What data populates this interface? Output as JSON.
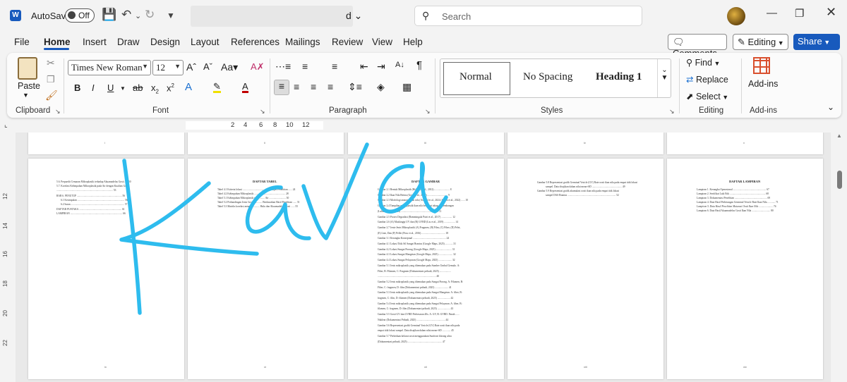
{
  "titlebar": {
    "app_letter": "W",
    "autosave_label": "AutoSave",
    "autosave_state": "Off",
    "doc_title_suffix": "d ⌄",
    "search_placeholder": "Search"
  },
  "tabs": [
    "File",
    "Home",
    "Insert",
    "Draw",
    "Design",
    "Layout",
    "References",
    "Mailings",
    "Review",
    "View",
    "Help"
  ],
  "active_tab": "Home",
  "actions": {
    "comments": "Comments",
    "editing": "Editing",
    "share": "Share"
  },
  "ribbon": {
    "clipboard": {
      "paste": "Paste",
      "label": "Clipboard"
    },
    "font": {
      "family": "Times New Roman",
      "size": "12",
      "label": "Font"
    },
    "paragraph": {
      "label": "Paragraph"
    },
    "styles": {
      "normal": "Normal",
      "no_spacing": "No Spacing",
      "heading1": "Heading 1",
      "label": "Styles"
    },
    "editing": {
      "find": "Find",
      "replace": "Replace",
      "select": "Select",
      "label": "Editing"
    },
    "addins": {
      "button": "Add-ins",
      "label": "Add-ins"
    }
  },
  "ruler": {
    "ticks": [
      "2",
      "4",
      "6",
      "8",
      "10",
      "12"
    ]
  },
  "vruler": {
    "ticks": [
      "12",
      "14",
      "16",
      "18",
      "20",
      "22"
    ]
  },
  "pages": {
    "top_numbers": [
      "i",
      "ii",
      "iii",
      "iv",
      "v"
    ],
    "p1": {
      "lines": [
        "5.6. Prepaedit Cemaran Mikroplastik terhadap Akuamadelus Gosti ..... 50",
        "5.7. Korelasi Kelimpahan Mikroplastik pada Air dengan Kualitas Gosti",
        "......................................................................................... 53",
        "BAB 6. PENUTUP ....................................................................... 56",
        "6.1 Kesimpulan .......................................................................... 56",
        "6.2 Saran .................................................................................... 57",
        "DAFTAR PUSTAKA ................................................................... 61",
        "LAMPIRAN .................................................................................. 66"
      ],
      "number": "ix"
    },
    "p2": {
      "title": "DAFTAR TABEL",
      "lines": [
        "Tabel 4.1 Kriteria lokasi ......................................... Sampel Penelitian ...... 24",
        "Tabel 4.2 Kelimpahan Mikroplastik ................................................. 28",
        "Tabel 5.1 Kelimpahan Mikroplastik pada ........ Air .......................... 30",
        "Tabel 5.2 Perbandingan Jenis Gosti ............. Berdasarkan Hasil Penelitian ...... 51",
        "Tabel 5.3 Matriks korelasi antara ............. Hulu dan Akuamadelus Gosti ...... 55"
      ],
      "number": "xi"
    },
    "p3": {
      "title": "DAFTAR GAMBAR",
      "lines": [
        "Gambar 2.1 Bentuk Mikroplastik (Hidalgo et al., 2012) ........................ 8",
        "Gambar 2.2 Ikan Nila Betina (Gosti et al., 2022) ................................ 9",
        "Gambar 2.3 Morfologi anatomi ikan nila (Asmaul et al., 2024; Sastra et al., 2022) ...... 10",
        "Gambar 2.4 Tampilan mikroplastik ikan nila berbagai tahap perkembangan",
        "(Lalameri et al., 2018) ........................................................... 11",
        "Gambar 2.5 Proses Degradasi (Bammingala Putri et al., 2017) ................. 12",
        "Gambar 2.6 (A) Muskingip UV dan (B) GVBD (Liu et al., 2019) ................. 14",
        "Gambar 2.7 Jenis-Jenis Mikroplastik (A) Fragmen, (B) Film, (C) Fiber, (D) Pelet,",
        "(E) Line, Dan (F) Pellet (Poso et al., 2016) ..................................... 18",
        "Gambar 3.1 Kerangka Konseptual .................................................... 24",
        "Gambar 4.1 Lokasi Titik Sil Sungai Brantas (Google Maps, 2025) ............ 31",
        "Gambar 4.2 Lokasi Sungai Porong (Google Maps, 2025) ......................... 31",
        "Gambar 4.3 Lokasi Sungai Mangetan (Google Maps, 2025) ...................... 32",
        "Gambar 4.4 Lokasi Sungai Pelayaran (Google Maps, 2025) ..................... 32",
        "Gambar 5.1 Jenis mikroplastik yang ditemukan pada Sumber Umbul Gemulo. A:",
        "Fiber, B: Filamen, C: Fragmen (Dokumentasi pribadi, 2025) ..................",
        "............................................................................................ 40",
        "Gambar 5.2 Jenis mikroplastik yang ditemukan pada Sungai Porong. A: Filamen, B:",
        "Fiber, C: fragmen, D: film (Dokumentasi pribadi, 2025) ..................... 41",
        "Gambar 5.3 Jenis mikroplastik yang ditemukan pada Sungai Mangetan. A: fiber, B:",
        "fragmen, C: film, D: filamen (Dokumentasi pribadi, 2025) .................... 42",
        "Gambar 5.4 Jenis mikroplastik yang ditemukan pada Sungai Pelayaran. A: fiber, B:",
        "filamen, C: fragmen, D: film (Dokumentasi pribadi, 2025) .................... 43",
        "Gambar 5.5 Gosti GV dan GVBD Perbesaran 40x. A: GV, B: GVBD. Panah ......",
        "Nuklear (Dokumentasi Pribadi, 2025) ............................................. 44",
        "Gambar 5.6 Representasi grafik Germinal Vesicle (GV) Rate oosit ikan nila pada",
        "empat titik lokasi sampel. Data disajikan dalam nilai mean+SD ............. 45",
        "Gambar 5.7 Perbedaan kelarut oosit menggunakan Sunfront khrong ultra",
        "(Dokumentasi pribadi, 2025) ...................................................... 47"
      ],
      "number": "xii"
    },
    "p4": {
      "lines": [
        "Gambar 5.8 Representasi grafik Germinal Vesicle (GV) Rate oosit ikan nila pada empat titik lokasi",
        "sampel. Data disajikan dalam nilai mean+SD ............................................... 49",
        "Gambar 5.9 Representasi grafik akumulasi oosit ikan nila pada empat titik lokasi",
        "sampel DAS Brantas ............................................................................ 52"
      ],
      "number": "xiii"
    },
    "p5": {
      "title": "DAFTAR LAMPIRAN",
      "lines": [
        "Lampiran 1. Kerangka Operasional .................................................... 67",
        "Lampiran 2. Sertifikat Laik Etik ........................................................ 68",
        "Lampiran 3. Dokumentasi Penelitian ................................................... 69",
        "Lampiran 4. Data Hasil Perhitungan Germinal Vesicle Rate Ikan Nila ............ 71",
        "Lampiran 5. Data Hasil Penelitian Maturasi Oosit Ikan Nila ...................... 76",
        "Lampiran 6. Data Hasil Akuamadelus Gosti Ikan Nila ............................. 80"
      ],
      "number": "xiv"
    }
  },
  "ink": {
    "color": "#2ebcee",
    "stroke_color_note": "cyan handwriting"
  }
}
